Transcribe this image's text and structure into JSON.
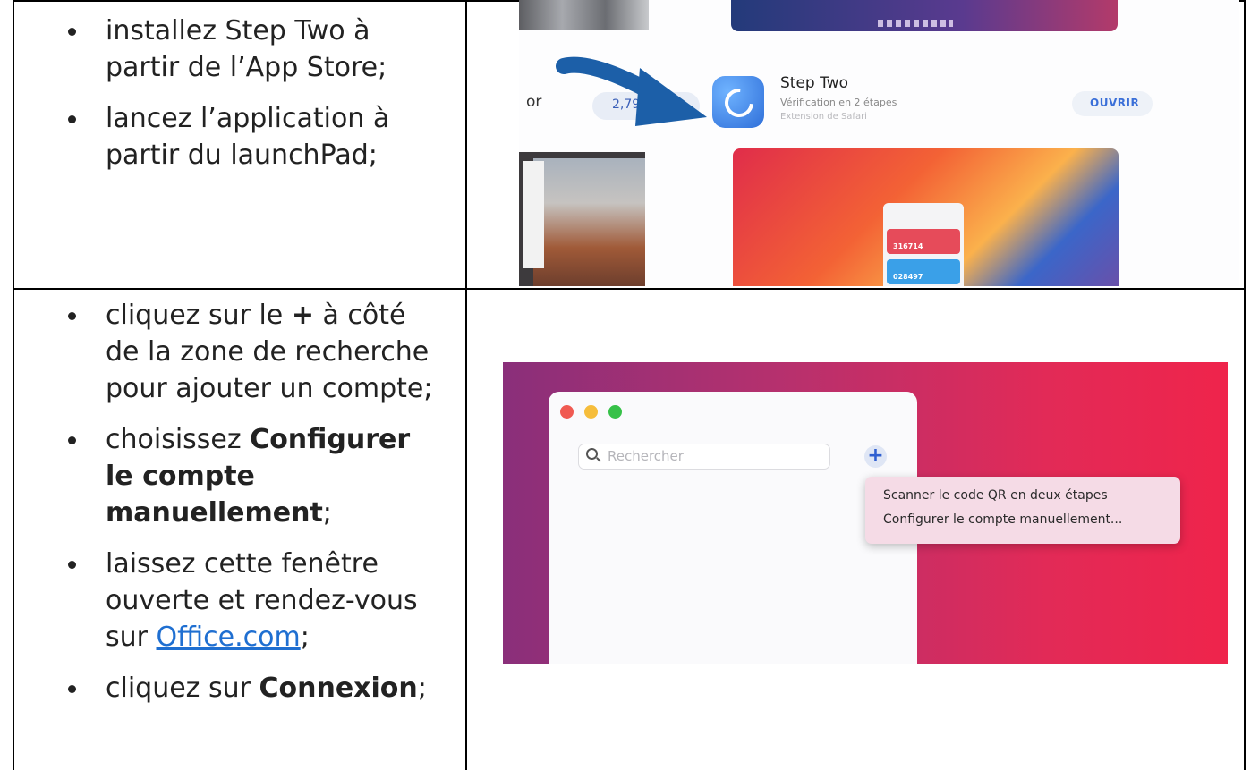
{
  "rows": [
    {
      "items": [
        {
          "text": "installez Step Two à partir de l’App Store;"
        },
        {
          "text": "lancez l’application à partir du launchPad;"
        }
      ],
      "screenshot": {
        "partial_label": "or",
        "price": "2,79",
        "app_name": "Step Two",
        "app_subtitle": "Vérification en 2 étapes",
        "app_category": "Extension de Safari",
        "open_button": "OUVRIR",
        "code_1": "316714",
        "code_2": "028497"
      }
    },
    {
      "items": [
        {
          "pre": "cliquez sur le ",
          "bold": "+",
          "post": " à côté de la zone de recherche pour ajouter un compte;"
        },
        {
          "pre": "choisissez ",
          "bold": "Configurer le compte manuellement",
          "post": ";"
        },
        {
          "pre": "laissez cette fenêtre ouverte et rendez-vous sur ",
          "link": "Office.com",
          "post": ";"
        },
        {
          "pre": "cliquez sur ",
          "bold": "Connexion",
          "post": ";"
        }
      ],
      "screenshot": {
        "search_placeholder": "Rechercher",
        "add_button": "+",
        "menu": [
          "Scanner le code QR en deux étapes",
          "Configurer le compte manuellement..."
        ],
        "traffic_colors": [
          "#f05a52",
          "#f6bd3b",
          "#36c148"
        ]
      }
    }
  ]
}
